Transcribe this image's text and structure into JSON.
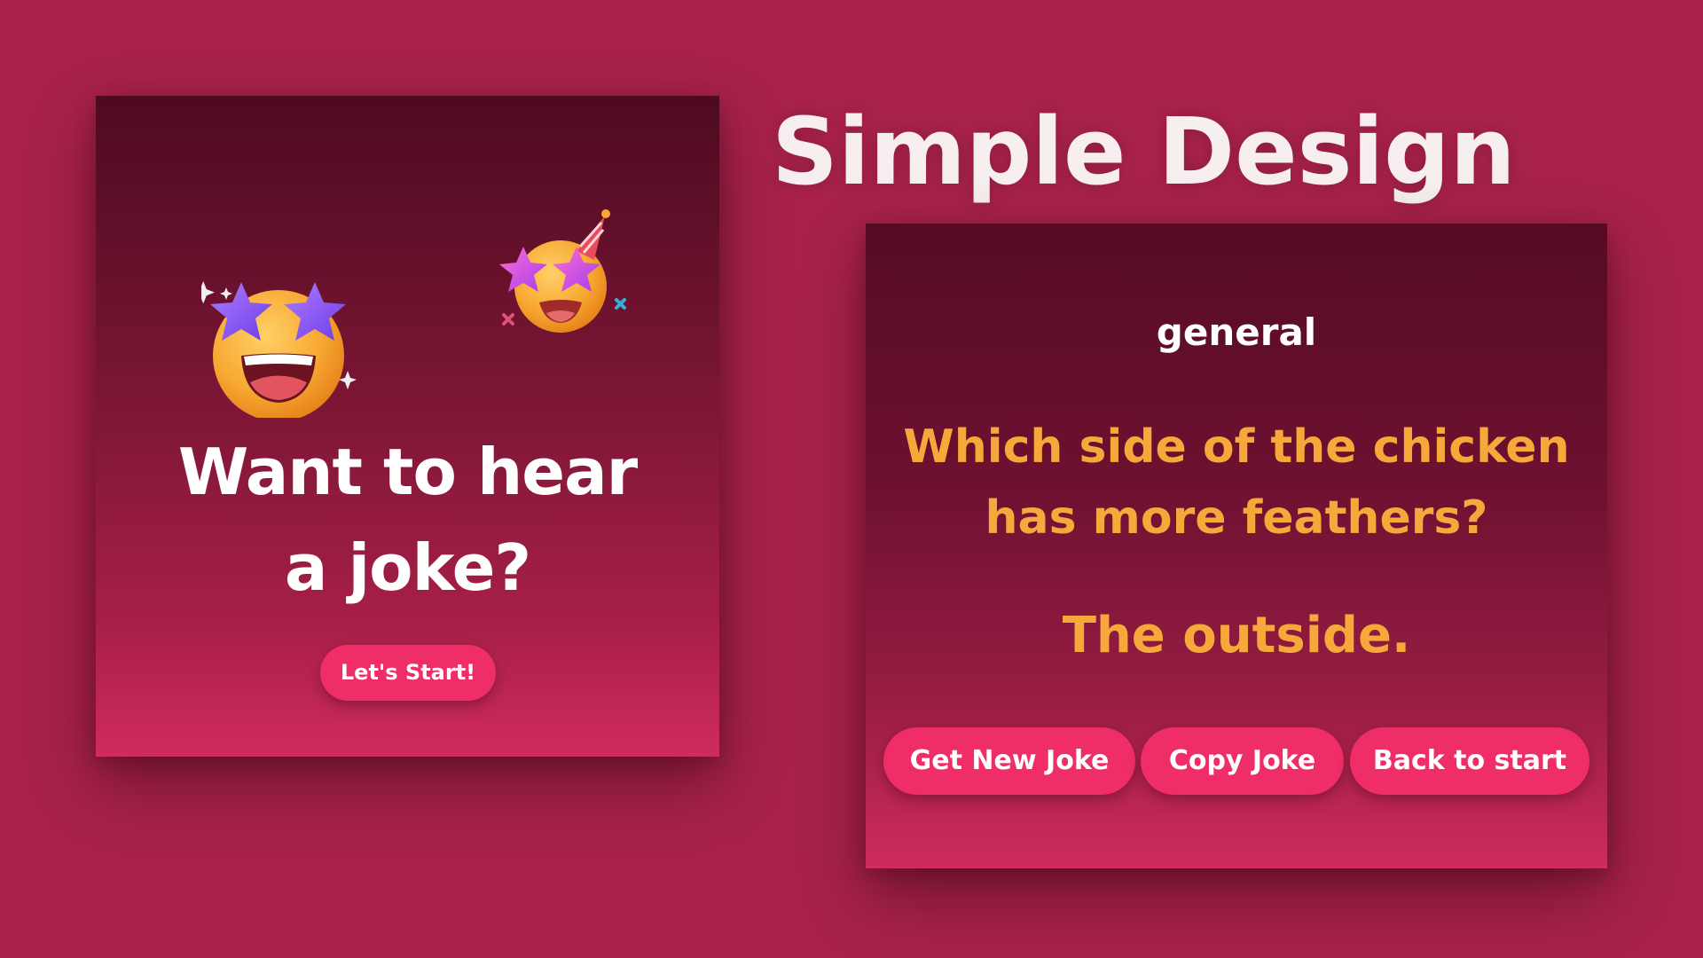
{
  "headline": "Simple Design",
  "start_card": {
    "title_line1": "Want to hear",
    "title_line2": "a joke?",
    "start_button": "Let's Start!",
    "big_emoji_icon": "star-struck-emoji-icon",
    "party_emoji_icon": "party-star-emoji-icon"
  },
  "joke_card": {
    "category": "general",
    "setup_line1": "Which side of the chicken",
    "setup_line2": "has more feathers?",
    "punchline": "The outside.",
    "buttons": {
      "new_joke": "Get New Joke",
      "copy_joke": "Copy Joke",
      "back": "Back to start"
    }
  },
  "colors": {
    "background": "#a9224b",
    "button": "#ef2d66",
    "joke_text": "#f6a93a",
    "white": "#ffffff"
  }
}
